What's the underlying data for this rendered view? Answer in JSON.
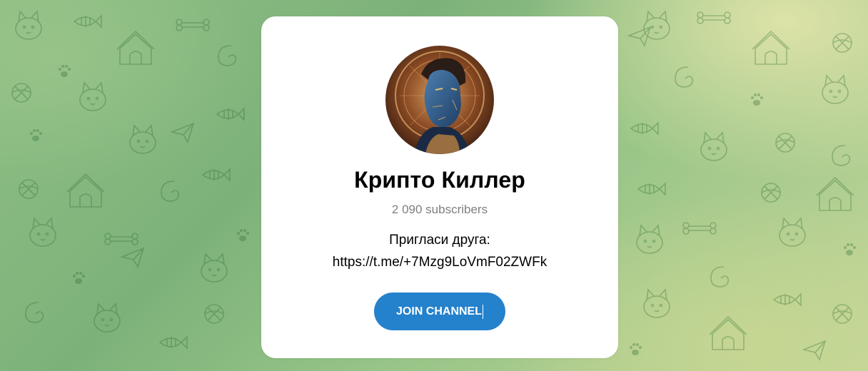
{
  "channel": {
    "title": "Крипто Киллер",
    "subscribers": "2 090 subscribers",
    "description_line1": "Пригласи друга:",
    "description_line2": "https://t.me/+7Mzg9LoVmF02ZWFk"
  },
  "join_button": {
    "label": "JOIN CHANNEL"
  },
  "avatar": {
    "icon": "avatar-portrait-icon"
  },
  "colors": {
    "accent": "#2481cc",
    "background_green": "#7cb27a",
    "background_yellow": "#e1e4aa",
    "card": "#ffffff",
    "subtitle": "#7f7f7f"
  }
}
